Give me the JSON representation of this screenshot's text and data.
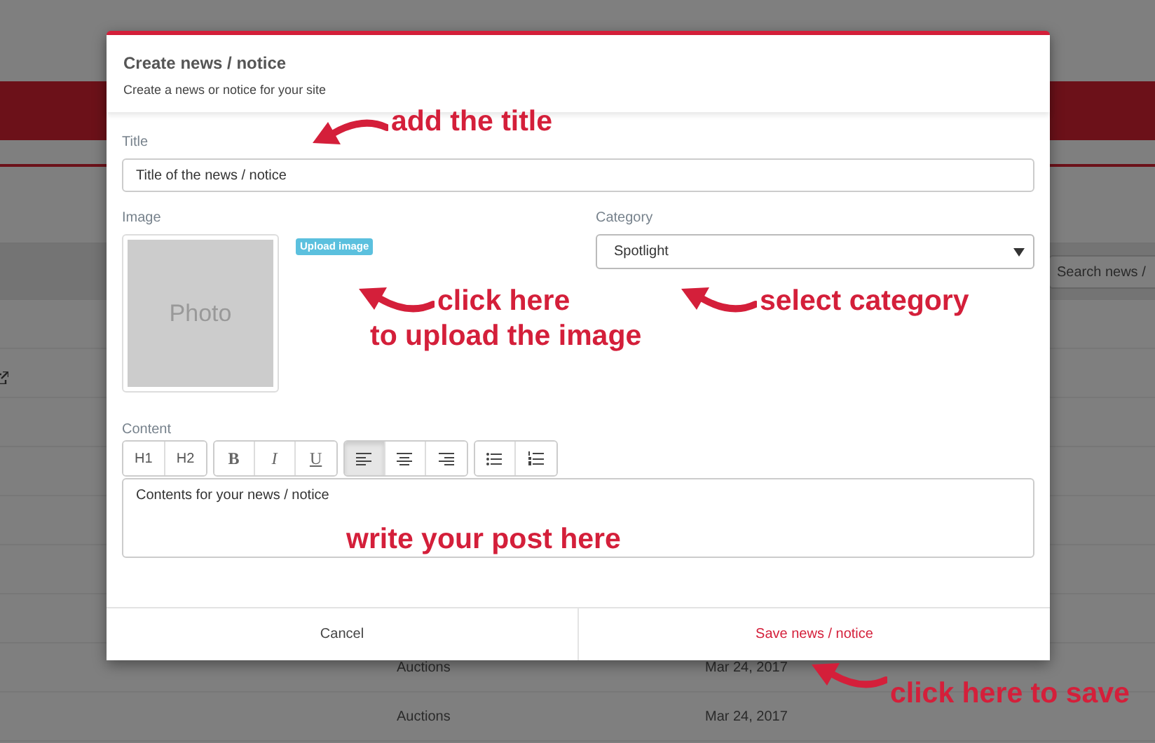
{
  "background": {
    "search": {
      "placeholder": "Search news /"
    },
    "rows": [
      {
        "category": "Auctions",
        "date": "Mar 24, 2017"
      },
      {
        "category": "Auctions",
        "date": "Mar 24, 2017"
      }
    ]
  },
  "dialog": {
    "title": "Create news / notice",
    "subtitle": "Create a news or notice for your site",
    "title_field": {
      "label": "Title",
      "value": "Title of the news / notice"
    },
    "image": {
      "label": "Image",
      "placeholder": "Photo",
      "upload_button": "Upload image"
    },
    "category": {
      "label": "Category",
      "value": "Spotlight"
    },
    "content": {
      "label": "Content",
      "value": "Contents for your news / notice",
      "toolbar": [
        [
          {
            "kind": "text",
            "label": "H1",
            "selected": false
          },
          {
            "kind": "text",
            "label": "H2",
            "selected": false
          }
        ],
        [
          {
            "kind": "bold",
            "label": "B",
            "selected": false
          },
          {
            "kind": "italic",
            "label": "I",
            "selected": false
          },
          {
            "kind": "underline",
            "label": "U",
            "selected": false
          }
        ],
        [
          {
            "kind": "left",
            "selected": true
          },
          {
            "kind": "center",
            "selected": false
          },
          {
            "kind": "right",
            "selected": false
          }
        ],
        [
          {
            "kind": "bullets",
            "selected": false
          },
          {
            "kind": "numbers",
            "selected": false
          }
        ]
      ]
    },
    "buttons": [
      {
        "kind": "cancel",
        "label": "Cancel"
      },
      {
        "kind": "save",
        "label": "Save news / notice"
      }
    ]
  },
  "annotations": [
    {
      "text": "add the title",
      "kind": "downarrow"
    },
    {
      "text": "click here",
      "kind": "uparrow"
    },
    {
      "text": "to upload the image",
      "kind": "plain"
    },
    {
      "text": "select category",
      "kind": "uparrow"
    },
    {
      "text": "write your post here",
      "kind": "plain"
    },
    {
      "text": "click here to save",
      "kind": "uparrow"
    }
  ]
}
